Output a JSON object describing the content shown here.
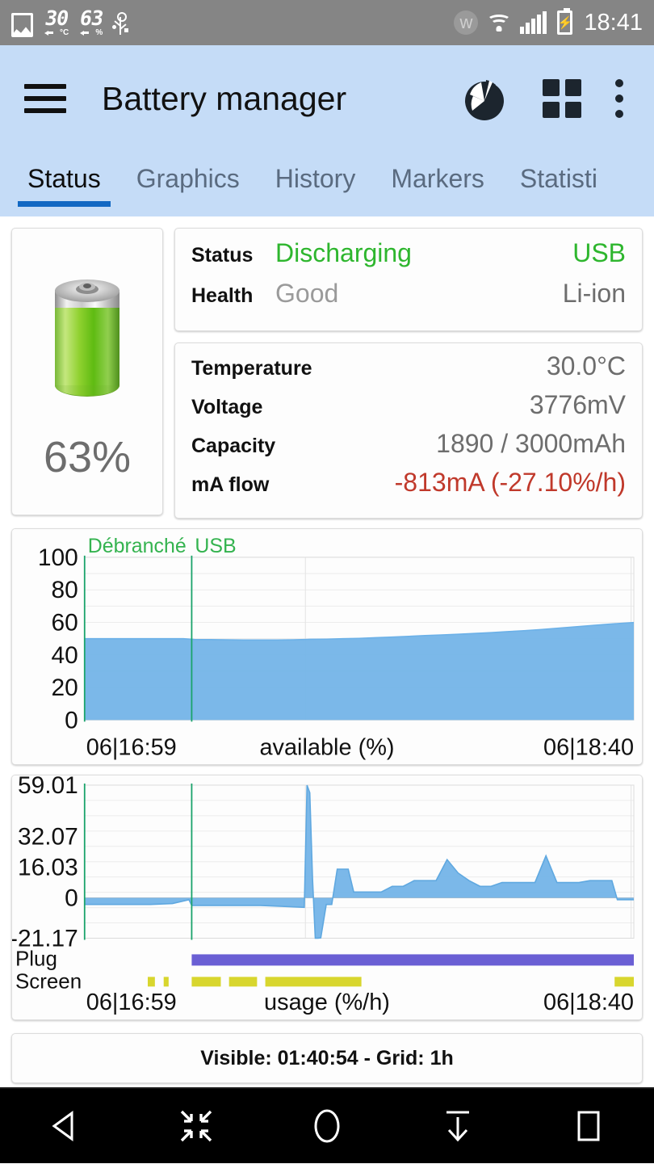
{
  "statusbar": {
    "gallery_icon": "gallery-icon",
    "temp_value": "30",
    "temp_unit": "°C",
    "level_value": "63",
    "level_unit": "%",
    "usb_icon": "usb-icon",
    "bluetooth_icon": "bluetooth-icon",
    "wifi_icon": "wifi-icon",
    "signal_icon": "signal-icon",
    "battery_icon": "battery-charging-icon",
    "clock": "18:41"
  },
  "appbar": {
    "menu_icon": "hamburger-menu-icon",
    "title": "Battery manager",
    "pie_icon": "pie-chart-icon",
    "grid_icon": "grid-view-icon",
    "overflow_icon": "more-vertical-icon"
  },
  "tabs": [
    {
      "label": "Status",
      "active": true
    },
    {
      "label": "Graphics",
      "active": false
    },
    {
      "label": "History",
      "active": false
    },
    {
      "label": "Markers",
      "active": false
    },
    {
      "label": "Statisti",
      "active": false
    }
  ],
  "battery": {
    "percent_label": "63%",
    "icon": "battery-cell-icon"
  },
  "status_card": {
    "rows": [
      {
        "label": "Status",
        "value": "Discharging",
        "right": "USB",
        "value_color": "#2eb62e",
        "right_color": "#2eb62e"
      },
      {
        "label": "Health",
        "value": "Good",
        "right": "Li-ion",
        "value_color": "#9a9a9a",
        "right_color": "#6d6d6d"
      }
    ]
  },
  "detail_card": {
    "rows": [
      {
        "label": "Temperature",
        "value": "30.0°C",
        "color": "#6d6d6d"
      },
      {
        "label": "Voltage",
        "value": "3776mV",
        "color": "#6d6d6d"
      },
      {
        "label": "Capacity",
        "value": "1890 / 3000mAh",
        "color": "#6d6d6d"
      },
      {
        "label": "mA flow",
        "value": "-813mA (-27.10%/h)",
        "color": "#c0392b"
      }
    ]
  },
  "footer": {
    "text": "Visible: 01:40:54 - Grid: 1h"
  },
  "navbar": {
    "buttons": [
      {
        "name": "back-button",
        "icon": "back-triangle-icon"
      },
      {
        "name": "shrink-button",
        "icon": "collapse-arrows-icon"
      },
      {
        "name": "home-button",
        "icon": "home-circle-icon"
      },
      {
        "name": "notification-pulldown-button",
        "icon": "arrow-down-bar-icon"
      },
      {
        "name": "recents-button",
        "icon": "square-icon"
      }
    ]
  },
  "chart_data": [
    {
      "type": "area",
      "title": "available (%)",
      "xlabel_left": "06|16:59",
      "xlabel_right": "06|18:40",
      "ylabel": "",
      "ylim": [
        0,
        100
      ],
      "yticks": [
        0,
        20,
        40,
        60,
        80,
        100
      ],
      "ytick_labels": [
        "0",
        "20",
        "40",
        "60",
        "80",
        "100"
      ],
      "grid": true,
      "series_color": "#6cb1e8",
      "fill_color": "#74b4e8",
      "markers": [
        {
          "label": "Débranché",
          "x_frac": 0.0,
          "color": "#1aa36b"
        },
        {
          "label": "USB",
          "x_frac": 0.195,
          "color": "#1aa36b"
        }
      ],
      "x": [
        0,
        0.03,
        0.06,
        0.09,
        0.12,
        0.15,
        0.18,
        0.2,
        0.23,
        0.26,
        0.29,
        0.32,
        0.35,
        0.38,
        0.41,
        0.44,
        0.47,
        0.5,
        0.53,
        0.56,
        0.59,
        0.62,
        0.65,
        0.68,
        0.71,
        0.74,
        0.77,
        0.8,
        0.83,
        0.86,
        0.89,
        0.92,
        0.95,
        0.98,
        1.0
      ],
      "values": [
        50,
        50,
        50,
        50,
        50,
        50,
        50,
        49.5,
        49.4,
        49.3,
        49.2,
        49.2,
        49.2,
        49.3,
        49.6,
        49.7,
        50,
        50.2,
        50.6,
        51,
        51.4,
        51.9,
        52.3,
        52.7,
        53.2,
        53.7,
        54.3,
        54.9,
        55.6,
        56.4,
        57.2,
        58,
        58.8,
        59.5,
        59.9
      ]
    },
    {
      "type": "area",
      "title": "usage (%/h)",
      "xlabel_left": "06|16:59",
      "xlabel_right": "06|18:40",
      "ylabel": "",
      "ylim": [
        -21.17,
        59.01
      ],
      "yticks": [
        -21.17,
        0,
        16.03,
        32.07,
        59.01
      ],
      "ytick_labels": [
        "-21.17",
        "0",
        "16.03",
        "32.07",
        "59.01"
      ],
      "grid": true,
      "series_color": "#5fa8e0",
      "fill_color": "#74b4e8",
      "markers": [
        {
          "label": "",
          "x_frac": 0.0,
          "color": "#1aa36b"
        },
        {
          "label": "",
          "x_frac": 0.195,
          "color": "#1aa36b"
        }
      ],
      "x": [
        0,
        0.04,
        0.08,
        0.12,
        0.16,
        0.19,
        0.195,
        0.24,
        0.28,
        0.32,
        0.36,
        0.4,
        0.405,
        0.41,
        0.415,
        0.42,
        0.425,
        0.43,
        0.44,
        0.45,
        0.46,
        0.47,
        0.48,
        0.49,
        0.5,
        0.52,
        0.54,
        0.56,
        0.58,
        0.6,
        0.62,
        0.64,
        0.66,
        0.68,
        0.7,
        0.72,
        0.74,
        0.76,
        0.78,
        0.8,
        0.82,
        0.84,
        0.86,
        0.88,
        0.9,
        0.92,
        0.94,
        0.96,
        0.97,
        1.0
      ],
      "values": [
        -3.5,
        -3.5,
        -3.5,
        -3.5,
        -3.0,
        -1.0,
        -4.0,
        -4.0,
        -4.0,
        -4.0,
        -4.5,
        -5.0,
        59.01,
        55,
        10,
        -21.17,
        -21.17,
        -21.0,
        -3.5,
        -3.5,
        15.0,
        15.0,
        15.0,
        3.0,
        3.0,
        3.0,
        3.0,
        6.0,
        6.0,
        9.0,
        9.0,
        9.0,
        20.0,
        13.0,
        9.0,
        6.0,
        6.0,
        8.0,
        8.0,
        8.0,
        8.0,
        22.0,
        8.0,
        8.0,
        8.0,
        9.0,
        9.0,
        9.0,
        -1.0,
        -1.0
      ]
    }
  ],
  "activity_rows": [
    {
      "label": "Plug",
      "color": "#6a5fd4",
      "segments": [
        {
          "start": 0.195,
          "end": 1.0
        }
      ]
    },
    {
      "label": "Screen",
      "color": "#d8d62e",
      "segments": [
        {
          "start": 0.115,
          "end": 0.128
        },
        {
          "start": 0.144,
          "end": 0.153
        },
        {
          "start": 0.195,
          "end": 0.248
        },
        {
          "start": 0.263,
          "end": 0.314
        },
        {
          "start": 0.329,
          "end": 0.504
        },
        {
          "start": 0.965,
          "end": 1.0
        }
      ]
    }
  ]
}
